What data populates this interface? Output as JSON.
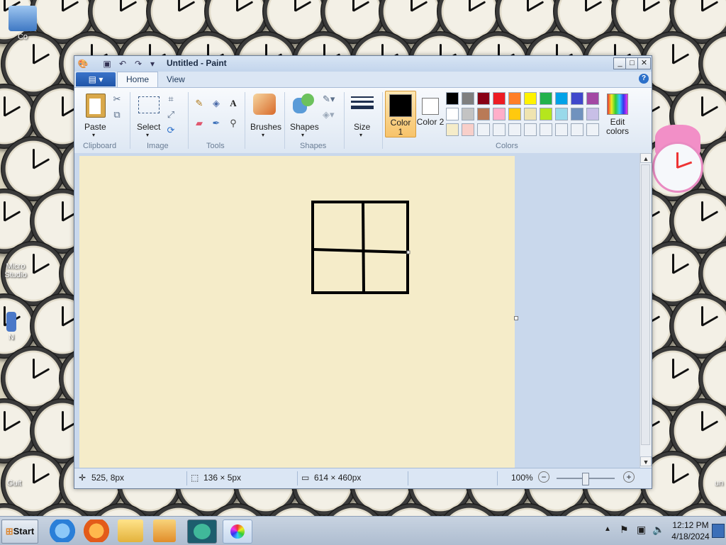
{
  "desktop": {
    "icons": [
      {
        "label": "Co"
      },
      {
        "label": "Micro Studio"
      },
      {
        "label": "N"
      },
      {
        "label": "Guit"
      },
      {
        "label": "un"
      }
    ]
  },
  "window": {
    "title": "Untitled - Paint",
    "quick_access": [
      "paint-app-icon",
      "save-icon",
      "undo-icon",
      "redo-icon",
      "customize-icon"
    ],
    "controls": {
      "minimize": "_",
      "maximize": "□",
      "close": "✕"
    },
    "file_menu_glyph": "▤ ▾",
    "tabs": [
      {
        "label": "Home",
        "active": true
      },
      {
        "label": "View",
        "active": false
      }
    ],
    "help_glyph": "?"
  },
  "ribbon": {
    "clipboard": {
      "paste_label": "Paste",
      "group_label": "Clipboard"
    },
    "image": {
      "select_label": "Select",
      "group_label": "Image"
    },
    "tools": {
      "group_label": "Tools"
    },
    "brushes": {
      "label": "Brushes"
    },
    "shapes": {
      "label": "Shapes",
      "group_label": "Shapes"
    },
    "size": {
      "label": "Size"
    },
    "color1": {
      "label": "Color 1",
      "value": "#000000"
    },
    "color2": {
      "label": "Color 2",
      "value": "#ffffff"
    },
    "colors": {
      "group_label": "Colors",
      "edit_label": "Edit colors",
      "palette_row1": [
        "#000000",
        "#7f7f7f",
        "#880015",
        "#ed1c24",
        "#ff7f27",
        "#fff200",
        "#22b14c",
        "#00a2e8",
        "#3f48cc",
        "#a349a4"
      ],
      "palette_row2": [
        "#ffffff",
        "#c3c3c3",
        "#b97a57",
        "#ffaec9",
        "#ffc90e",
        "#efe4b0",
        "#b5e61d",
        "#99d9ea",
        "#7092be",
        "#c8bfe7"
      ],
      "palette_row3": [
        "#f5ecc9",
        "#f8cfc9",
        "",
        "",
        "",
        "",
        "",
        "",
        "",
        ""
      ]
    }
  },
  "canvas": {
    "background": "#f5ecc9"
  },
  "status": {
    "cursor_pos": "525, 8px",
    "selection_size": "136 × 5px",
    "image_size": "614 × 460px",
    "zoom": "100%"
  },
  "taskbar": {
    "start_label": "Start",
    "time": "12:12 PM",
    "date": "4/18/2024"
  }
}
